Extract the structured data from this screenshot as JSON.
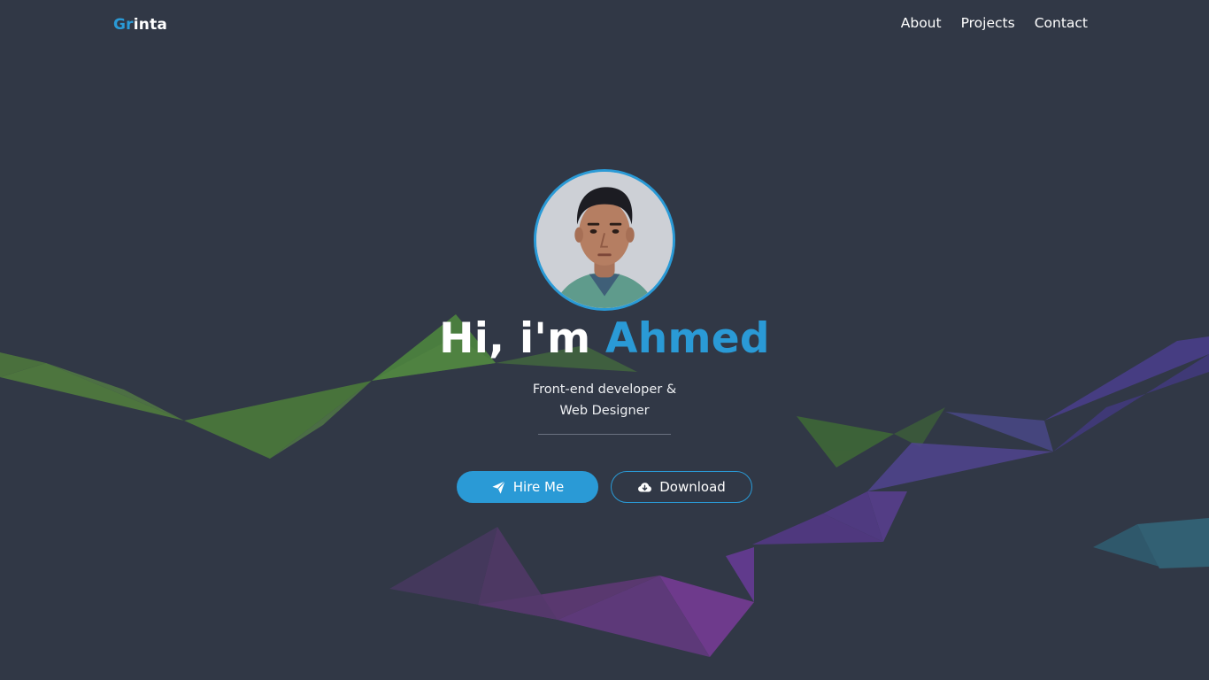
{
  "brand": {
    "accent": "Gr",
    "rest": "inta",
    "accent_color": "#2a9ad6"
  },
  "nav": {
    "items": [
      {
        "label": "About"
      },
      {
        "label": "Projects"
      },
      {
        "label": "Contact"
      }
    ]
  },
  "hero": {
    "greeting": "Hi, i'm ",
    "name": "Ahmed",
    "subtitle_line1": "Front-end developer &",
    "subtitle_line2": "Web Designer",
    "avatar_icon": "profile-photo"
  },
  "actions": {
    "hire": {
      "label": "Hire Me",
      "icon": "paper-plane-icon"
    },
    "download": {
      "label": "Download",
      "icon": "cloud-download-icon"
    }
  },
  "colors": {
    "background": "#313846",
    "accent": "#2a9ad6",
    "text": "#ffffff"
  }
}
